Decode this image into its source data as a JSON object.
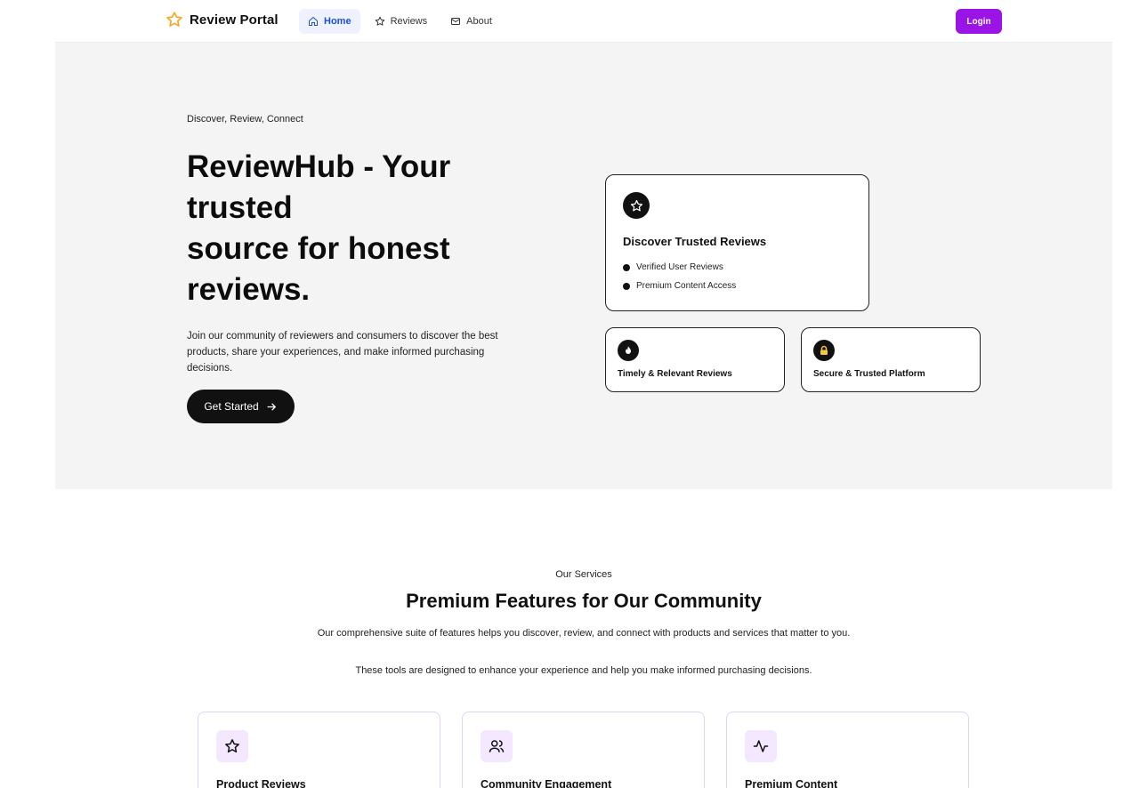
{
  "nav": {
    "brand": "Review Portal",
    "links": [
      {
        "label": "Home",
        "icon": "home-icon",
        "active": true
      },
      {
        "label": "Reviews",
        "icon": "star-icon",
        "active": false
      },
      {
        "label": "About",
        "icon": "mail-icon",
        "active": false
      }
    ],
    "login_label": "Login"
  },
  "hero": {
    "eyebrow": "Discover, Review, Connect",
    "title_line1": "ReviewHub - Your",
    "title_line2": "trusted",
    "title_line3": "source for honest",
    "title_line4": "reviews.",
    "description": "Join our community of reviewers and consumers to discover the best products, share your experiences, and make informed purchasing decisions.",
    "cta_label": "Get Started",
    "main_card": {
      "title": "Discover Trusted Reviews",
      "bullets": [
        "Verified User Reviews",
        "Premium Content Access"
      ]
    },
    "small_cards": [
      {
        "title": "Timely & Relevant Reviews",
        "icon": "flame-icon"
      },
      {
        "title": "Secure & Trusted Platform",
        "icon": "lock-icon"
      }
    ]
  },
  "services": {
    "eyebrow": "Our Services",
    "title": "Premium Features for Our Community",
    "description": "Our comprehensive suite of features helps you discover, review, and connect with products and services that matter to you.",
    "description2": "These tools are designed to enhance your experience and help you make informed purchasing decisions.",
    "features": [
      {
        "title": "Product Reviews",
        "icon": "star-icon"
      },
      {
        "title": "Community Engagement",
        "icon": "users-icon"
      },
      {
        "title": "Premium Content",
        "icon": "activity-icon"
      }
    ]
  },
  "colors": {
    "accent": "#9b14e6",
    "brand_star": "#f5a623",
    "nav_active_bg": "#eef2ff",
    "nav_active_text": "#1d4ed8",
    "hero_bg": "#f4f4f4",
    "feature_icon_bg": "#f3e8ff"
  }
}
